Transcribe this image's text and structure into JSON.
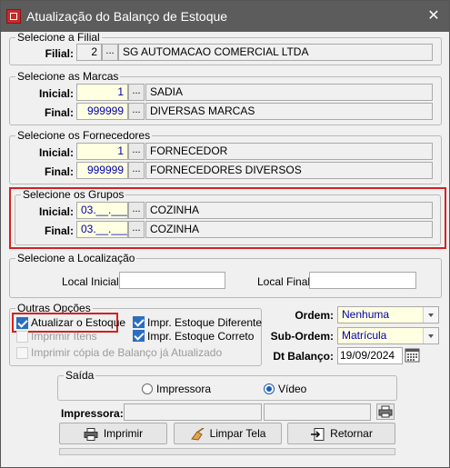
{
  "window": {
    "title": "Atualização do Balanço de Estoque",
    "close_glyph": "✕"
  },
  "filial": {
    "legend": "Selecione a Filial",
    "label": "Filial:",
    "code": "2",
    "name": "SG AUTOMACAO COMERCIAL LTDA"
  },
  "marcas": {
    "legend": "Selecione as Marcas",
    "initial": {
      "label": "Inicial:",
      "code": "1",
      "name": "SADIA"
    },
    "final": {
      "label": "Final:",
      "code": "999999",
      "name": "DIVERSAS MARCAS"
    }
  },
  "fornecedores": {
    "legend": "Selecione os Fornecedores",
    "initial": {
      "label": "Inicial:",
      "code": "1",
      "name": "FORNECEDOR"
    },
    "final": {
      "label": "Final:",
      "code": "999999",
      "name": "FORNECEDORES DIVERSOS"
    }
  },
  "grupos": {
    "legend": "Selecione os Grupos",
    "initial": {
      "label": "Inicial:",
      "code": "03.__.___",
      "name": "COZINHA"
    },
    "final": {
      "label": "Final:",
      "code": "03.__.___",
      "name": "COZINHA"
    }
  },
  "localizacao": {
    "legend": "Selecione a Localização",
    "initial_label": "Local Inicial:",
    "final_label": "Local Final:",
    "initial_value": "",
    "final_value": ""
  },
  "opcoes": {
    "legend": "Outras Opções",
    "atualizar_estoque": {
      "label": "Atualizar o Estoque",
      "checked": true
    },
    "imprimir_itens": {
      "label": "Imprimir Itens",
      "checked": false,
      "disabled": true
    },
    "impr_diferente": {
      "label": "Impr. Estoque Diferente",
      "checked": true
    },
    "impr_correto": {
      "label": "Impr. Estoque Correto",
      "checked": true
    },
    "imprimir_copia": {
      "label": "Imprimir cópia de Balanço já Atualizado",
      "checked": false,
      "disabled": true
    }
  },
  "ordem": {
    "label": "Ordem:",
    "value": "Nenhuma"
  },
  "sub_ordem": {
    "label": "Sub-Ordem:",
    "value": "Matrícula"
  },
  "dt_balanco": {
    "label": "Dt Balanço:",
    "value": "19/09/2024"
  },
  "saida": {
    "legend": "Saída",
    "impressora_option": "Impressora",
    "video_option": "Vídeo",
    "selected": "Vídeo",
    "impressora_label": "Impressora:",
    "impressora_value": ""
  },
  "buttons": {
    "imprimir": "Imprimir",
    "limpar": "Limpar Tela",
    "retornar": "Retornar"
  },
  "colors": {
    "titlebar": "#5c5c5c",
    "highlight": "#d62020",
    "input_yellow": "#ffffe1",
    "input_text": "#0000b0"
  },
  "icons": [
    "close-icon",
    "printer-icon",
    "eraser-icon",
    "return-icon",
    "calendar-icon"
  ]
}
